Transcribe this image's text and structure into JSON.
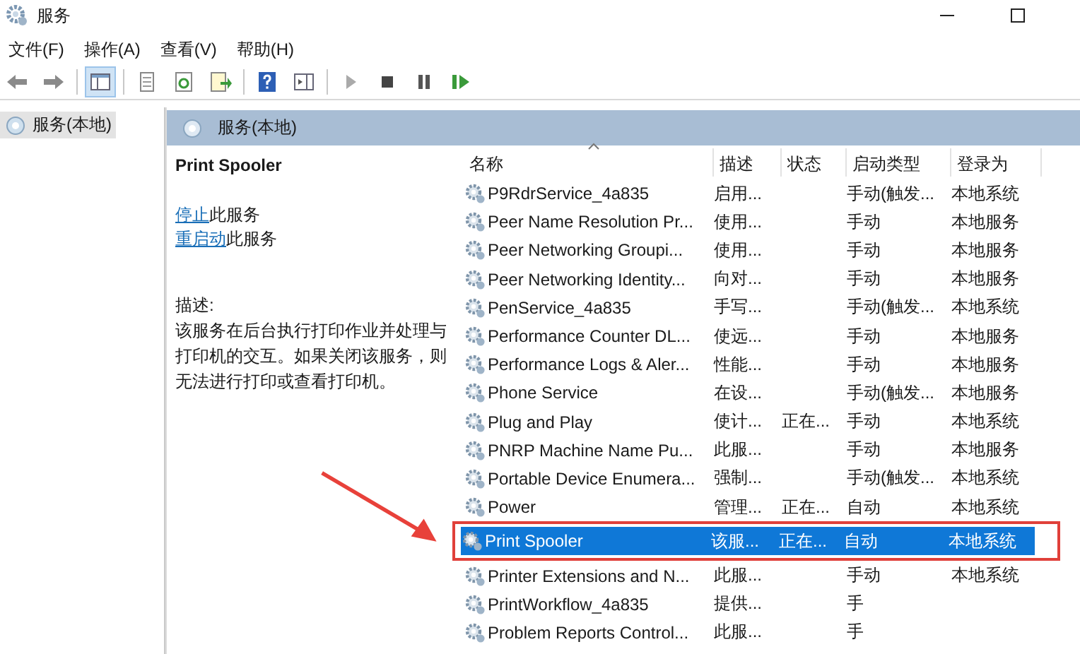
{
  "window": {
    "title": "服务"
  },
  "menu": [
    "文件(F)",
    "操作(A)",
    "查看(V)",
    "帮助(H)"
  ],
  "tree": {
    "items": [
      {
        "label": "服务(本地)",
        "selected": true
      }
    ]
  },
  "panel": {
    "title": "服务(本地)"
  },
  "details": {
    "service_name": "Print Spooler",
    "actions": [
      {
        "link": "停止",
        "text": "此服务"
      },
      {
        "link": "重启动",
        "text": "此服务"
      }
    ],
    "description_label": "描述:",
    "description": "该服务在后台执行打印作业并处理与打印机的交互。如果关闭该服务，则无法进行打印或查看打印机。"
  },
  "table": {
    "columns": [
      "名称",
      "描述",
      "状态",
      "启动类型",
      "登录为"
    ],
    "rows": [
      {
        "name": "P9RdrService_4a835",
        "description": "启用...",
        "startup_type": "手动(触发...",
        "log_on_as": "本地系统",
        "selected": false
      },
      {
        "name": "Peer Name Resolution Pr...",
        "description": "使用...",
        "startup_type": "手动",
        "log_on_as": "本地服务",
        "selected": false
      },
      {
        "name": "Peer Networking Groupi...",
        "description": "使用...",
        "startup_type": "手动",
        "log_on_as": "本地服务",
        "selected": false
      },
      {
        "name": "Peer Networking Identity...",
        "description": "向对...",
        "startup_type": "手动",
        "log_on_as": "本地服务",
        "selected": false
      },
      {
        "name": "PenService_4a835",
        "description": "手写...",
        "startup_type": "手动(触发...",
        "log_on_as": "本地系统",
        "selected": false
      },
      {
        "name": "Performance Counter DL...",
        "description": "使远...",
        "startup_type": "手动",
        "log_on_as": "本地服务",
        "selected": false
      },
      {
        "name": "Performance Logs & Aler...",
        "description": "性能...",
        "startup_type": "手动",
        "log_on_as": "本地服务",
        "selected": false
      },
      {
        "name": "Phone Service",
        "description": "在设...",
        "startup_type": "手动(触发...",
        "log_on_as": "本地服务",
        "selected": false
      },
      {
        "name": "Plug and Play",
        "description": "使计...",
        "status": "正在...",
        "startup_type": "手动",
        "log_on_as": "本地系统",
        "selected": false
      },
      {
        "name": "PNRP Machine Name Pu...",
        "description": "此服...",
        "startup_type": "手动",
        "log_on_as": "本地服务",
        "selected": false
      },
      {
        "name": "Portable Device Enumera...",
        "description": "强制...",
        "startup_type": "手动(触发...",
        "log_on_as": "本地系统",
        "selected": false
      },
      {
        "name": "Power",
        "description": "管理...",
        "status": "正在...",
        "startup_type": "自动",
        "log_on_as": "本地系统",
        "selected": false
      },
      {
        "name": "Print Spooler",
        "description": "该服...",
        "status": "正在...",
        "startup_type": "自动",
        "log_on_as": "本地系统",
        "selected": true
      },
      {
        "name": "Printer Extensions and N...",
        "description": "此服...",
        "startup_type": "手动",
        "log_on_as": "本地系统",
        "selected": false
      },
      {
        "name": "PrintWorkflow_4a835",
        "description": "提供...",
        "startup_type": "手",
        "selected": false
      },
      {
        "name": "Problem Reports Control...",
        "description": "此服...",
        "startup_type": "手",
        "selected": false
      }
    ]
  }
}
